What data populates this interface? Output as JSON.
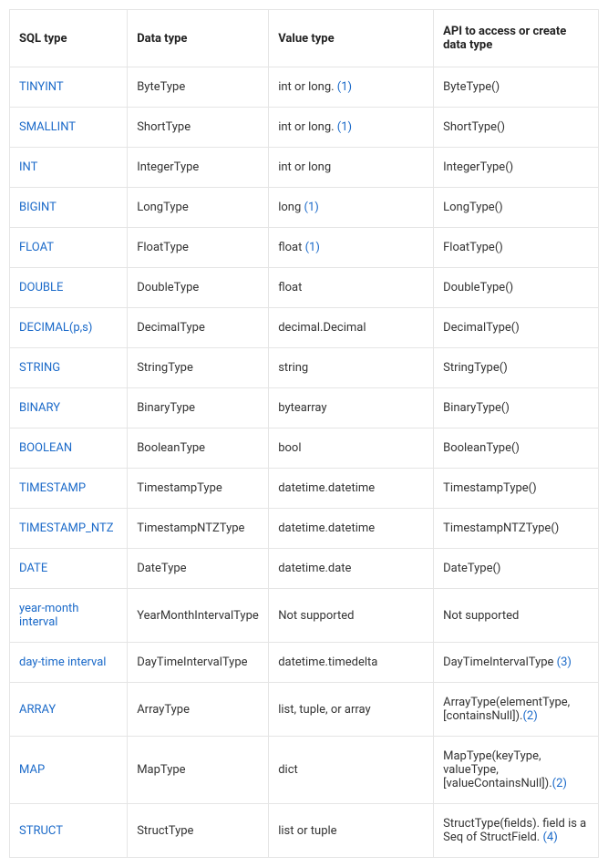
{
  "headers": {
    "sql_type": "SQL type",
    "data_type": "Data type",
    "value_type": "Value type",
    "api": "API to access or create data type"
  },
  "rows": [
    {
      "sql": "TINYINT",
      "data": "ByteType",
      "value_pre": "int or long. ",
      "value_ref": "(1)",
      "value_post": "",
      "api_pre": "ByteType()",
      "api_ref": "",
      "api_post": ""
    },
    {
      "sql": "SMALLINT",
      "data": "ShortType",
      "value_pre": "int or long. ",
      "value_ref": "(1)",
      "value_post": "",
      "api_pre": "ShortType()",
      "api_ref": "",
      "api_post": ""
    },
    {
      "sql": "INT",
      "data": "IntegerType",
      "value_pre": "int or long",
      "value_ref": "",
      "value_post": "",
      "api_pre": "IntegerType()",
      "api_ref": "",
      "api_post": ""
    },
    {
      "sql": "BIGINT",
      "data": "LongType",
      "value_pre": "long ",
      "value_ref": "(1)",
      "value_post": "",
      "api_pre": "LongType()",
      "api_ref": "",
      "api_post": ""
    },
    {
      "sql": "FLOAT",
      "data": "FloatType",
      "value_pre": "float ",
      "value_ref": "(1)",
      "value_post": "",
      "api_pre": "FloatType()",
      "api_ref": "",
      "api_post": ""
    },
    {
      "sql": "DOUBLE",
      "data": "DoubleType",
      "value_pre": "float",
      "value_ref": "",
      "value_post": "",
      "api_pre": "DoubleType()",
      "api_ref": "",
      "api_post": ""
    },
    {
      "sql": "DECIMAL(p,s)",
      "data": "DecimalType",
      "value_pre": "decimal.Decimal",
      "value_ref": "",
      "value_post": "",
      "api_pre": "DecimalType()",
      "api_ref": "",
      "api_post": ""
    },
    {
      "sql": "STRING",
      "data": "StringType",
      "value_pre": "string",
      "value_ref": "",
      "value_post": "",
      "api_pre": "StringType()",
      "api_ref": "",
      "api_post": ""
    },
    {
      "sql": "BINARY",
      "data": "BinaryType",
      "value_pre": "bytearray",
      "value_ref": "",
      "value_post": "",
      "api_pre": "BinaryType()",
      "api_ref": "",
      "api_post": ""
    },
    {
      "sql": "BOOLEAN",
      "data": "BooleanType",
      "value_pre": "bool",
      "value_ref": "",
      "value_post": "",
      "api_pre": "BooleanType()",
      "api_ref": "",
      "api_post": ""
    },
    {
      "sql": "TIMESTAMP",
      "data": "TimestampType",
      "value_pre": "datetime.datetime",
      "value_ref": "",
      "value_post": "",
      "api_pre": "TimestampType()",
      "api_ref": "",
      "api_post": ""
    },
    {
      "sql": "TIMESTAMP_NTZ",
      "data": "TimestampNTZType",
      "value_pre": "datetime.datetime",
      "value_ref": "",
      "value_post": "",
      "api_pre": "TimestampNTZType()",
      "api_ref": "",
      "api_post": ""
    },
    {
      "sql": "DATE",
      "data": "DateType",
      "value_pre": "datetime.date",
      "value_ref": "",
      "value_post": "",
      "api_pre": "DateType()",
      "api_ref": "",
      "api_post": ""
    },
    {
      "sql": "year-month interval",
      "data": "YearMonthIntervalType",
      "value_pre": "Not supported",
      "value_ref": "",
      "value_post": "",
      "api_pre": "Not supported",
      "api_ref": "",
      "api_post": ""
    },
    {
      "sql": "day-time interval",
      "data": "DayTimeIntervalType",
      "value_pre": "datetime.timedelta",
      "value_ref": "",
      "value_post": "",
      "api_pre": "DayTimeIntervalType ",
      "api_ref": "(3)",
      "api_post": ""
    },
    {
      "sql": "ARRAY",
      "data": "ArrayType",
      "value_pre": "list, tuple, or array",
      "value_ref": "",
      "value_post": "",
      "api_pre": "ArrayType(elementType, [containsNull]).",
      "api_ref": "(2)",
      "api_post": ""
    },
    {
      "sql": "MAP",
      "data": "MapType",
      "value_pre": "dict",
      "value_ref": "",
      "value_post": "",
      "api_pre": "MapType(keyType, valueType, [valueContainsNull]).",
      "api_ref": "(2)",
      "api_post": ""
    },
    {
      "sql": "STRUCT",
      "data": "StructType",
      "value_pre": "list or tuple",
      "value_ref": "",
      "value_post": "",
      "api_pre": "StructType(fields). field is a Seq of StructField. ",
      "api_ref": "(4)",
      "api_post": ""
    }
  ]
}
